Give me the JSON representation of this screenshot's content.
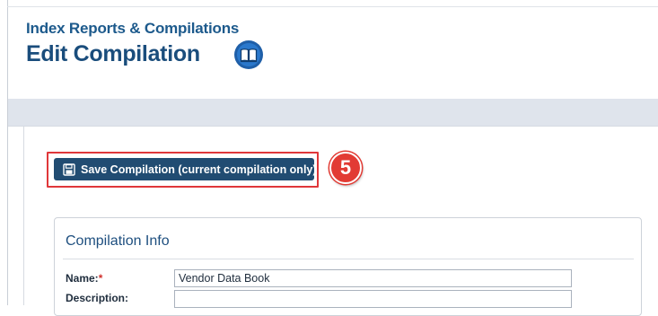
{
  "header": {
    "breadcrumb": "Index Reports & Compilations",
    "title": "Edit Compilation",
    "help_icon": "book-icon"
  },
  "toolbar": {
    "save_label": "Save Compilation (current compilation only)",
    "save_icon": "floppy-disk-icon"
  },
  "annotation": {
    "step_number": "5",
    "highlight_color": "#e0373a"
  },
  "panel": {
    "title": "Compilation Info",
    "fields": [
      {
        "label": "Name:",
        "required_mark": "*",
        "value": "Vendor Data Book"
      },
      {
        "label": "Description:",
        "value": ""
      }
    ]
  },
  "colors": {
    "primary": "#214c72",
    "heading": "#1a4d7c",
    "band": "#dfe4ec"
  }
}
